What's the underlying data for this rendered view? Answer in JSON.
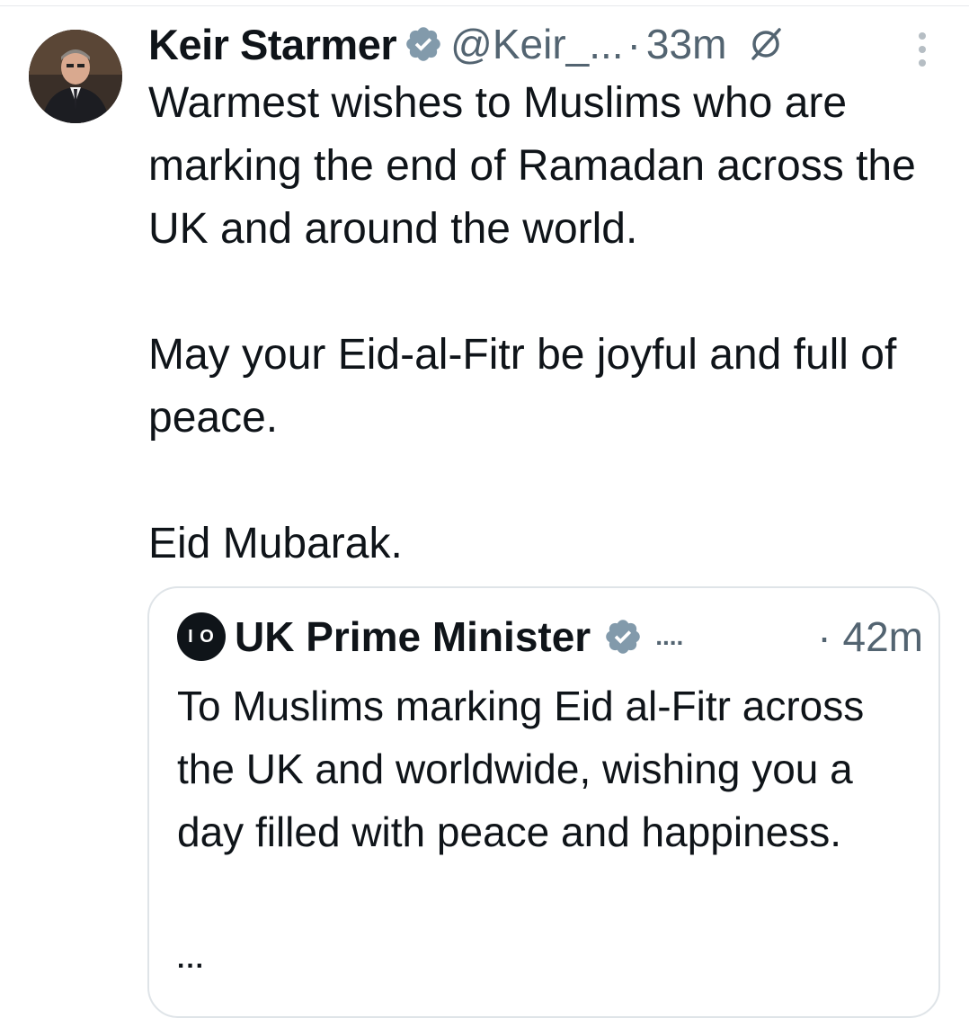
{
  "tweet": {
    "author": {
      "display_name": "Keir Starmer",
      "handle": "@Keir_...",
      "verified_icon": "verified-badge-icon",
      "avatar": "portrait-avatar"
    },
    "separator": "·",
    "time": "33m",
    "grok_icon": "grok-icon",
    "more_icon": "more-options-icon",
    "text": {
      "line1": "Warmest wishes to Muslims who are marking the end of Ramadan across the UK and around the world.",
      "line2": "May your Eid-al-Fitr be joyful and full of peace.",
      "line3": "Eid Mubarak."
    }
  },
  "quoted_tweet": {
    "author": {
      "display_name": "UK Prime Minister",
      "avatar_text": "I O",
      "verified_icon": "verified-badge-icon",
      "handle_truncated": "...."
    },
    "separator": "·",
    "time": "42m",
    "text": "To Muslims marking Eid al-Fitr across the UK and worldwide, wishing you a day filled with peace and happiness.",
    "more": "..."
  },
  "colors": {
    "text_primary": "#0f1419",
    "text_secondary": "#536471",
    "verified_badge": "#829aab",
    "border": "#dfe4e8"
  }
}
